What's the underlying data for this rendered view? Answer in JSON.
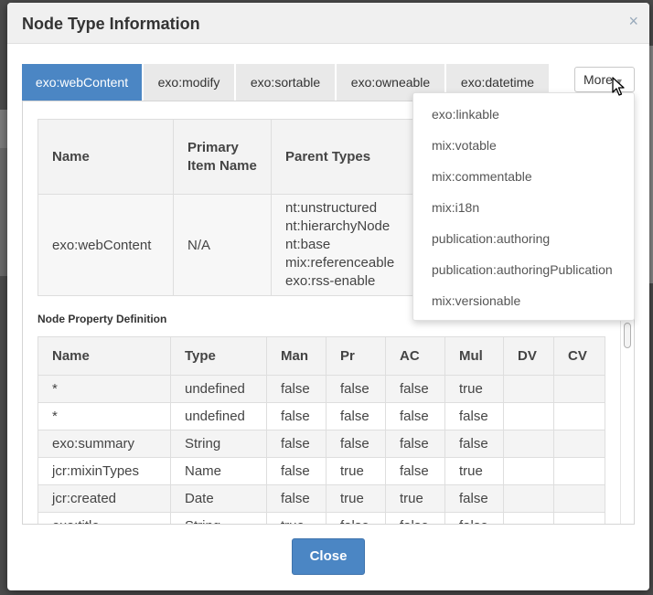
{
  "dialog": {
    "title": "Node Type Information",
    "close_icon": "×"
  },
  "tabs": [
    {
      "label": "exo:webContent"
    },
    {
      "label": "exo:modify"
    },
    {
      "label": "exo:sortable"
    },
    {
      "label": "exo:owneable"
    },
    {
      "label": "exo:datetime"
    }
  ],
  "more": {
    "label": "More"
  },
  "dropdown": {
    "items": [
      "exo:linkable",
      "mix:votable",
      "mix:commentable",
      "mix:i18n",
      "publication:authoring",
      "publication:authoringPublication",
      "mix:versionable"
    ]
  },
  "node_type_table": {
    "headers": {
      "name": "Name",
      "primary_item": "Primary Item Name",
      "parent_types": "Parent Types"
    },
    "row": {
      "name": "exo:webContent",
      "primary_item": "N/A",
      "parent_types": [
        "nt:unstructured",
        "nt:hierarchyNode",
        "nt:base",
        "mix:referenceable",
        "exo:rss-enable"
      ]
    }
  },
  "property_section": {
    "title": "Node Property Definition"
  },
  "property_table": {
    "headers": [
      "Name",
      "Type",
      "Man",
      "Pr",
      "AC",
      "Mul",
      "DV",
      "CV"
    ],
    "rows": [
      [
        "*",
        "undefined",
        "false",
        "false",
        "false",
        "true",
        "",
        ""
      ],
      [
        "*",
        "undefined",
        "false",
        "false",
        "false",
        "false",
        "",
        ""
      ],
      [
        "exo:summary",
        "String",
        "false",
        "false",
        "false",
        "false",
        "",
        ""
      ],
      [
        "jcr:mixinTypes",
        "Name",
        "false",
        "true",
        "false",
        "true",
        "",
        ""
      ],
      [
        "jcr:created",
        "Date",
        "false",
        "true",
        "true",
        "false",
        "",
        ""
      ],
      [
        "exo:title",
        "String",
        "true",
        "false",
        "false",
        "false",
        "",
        ""
      ]
    ]
  },
  "footer": {
    "close_label": "Close"
  },
  "colors": {
    "accent": "#4b86c4",
    "header_bg": "#f0f0f0",
    "row_alt": "#f4f4f4"
  }
}
